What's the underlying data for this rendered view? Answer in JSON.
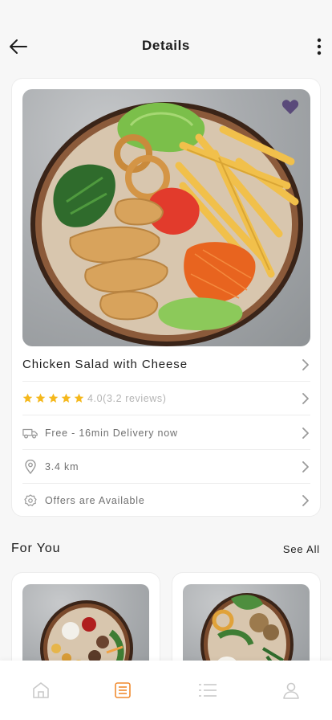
{
  "header": {
    "title": "Details",
    "back_icon": "arrow-left-icon",
    "more_icon": "more-vertical-icon"
  },
  "product": {
    "name": "Chicken Salad with Cheese",
    "favorite": true,
    "rating": {
      "stars": 5,
      "text": "4.0(3.2 reviews)"
    },
    "delivery": "Free - 16min Delivery now",
    "distance": "3.4 km",
    "offers": "Offers are Available"
  },
  "for_you": {
    "title": "For You",
    "see_all": "See All"
  },
  "nav": {
    "items": [
      "home-icon",
      "menu-list-icon",
      "list-icon",
      "profile-icon"
    ],
    "active_index": 1
  },
  "colors": {
    "accent": "#f08a2e",
    "star": "#f5b81c",
    "favorite": "#5a4a7a",
    "nav_inactive": "#c9c9c9"
  }
}
